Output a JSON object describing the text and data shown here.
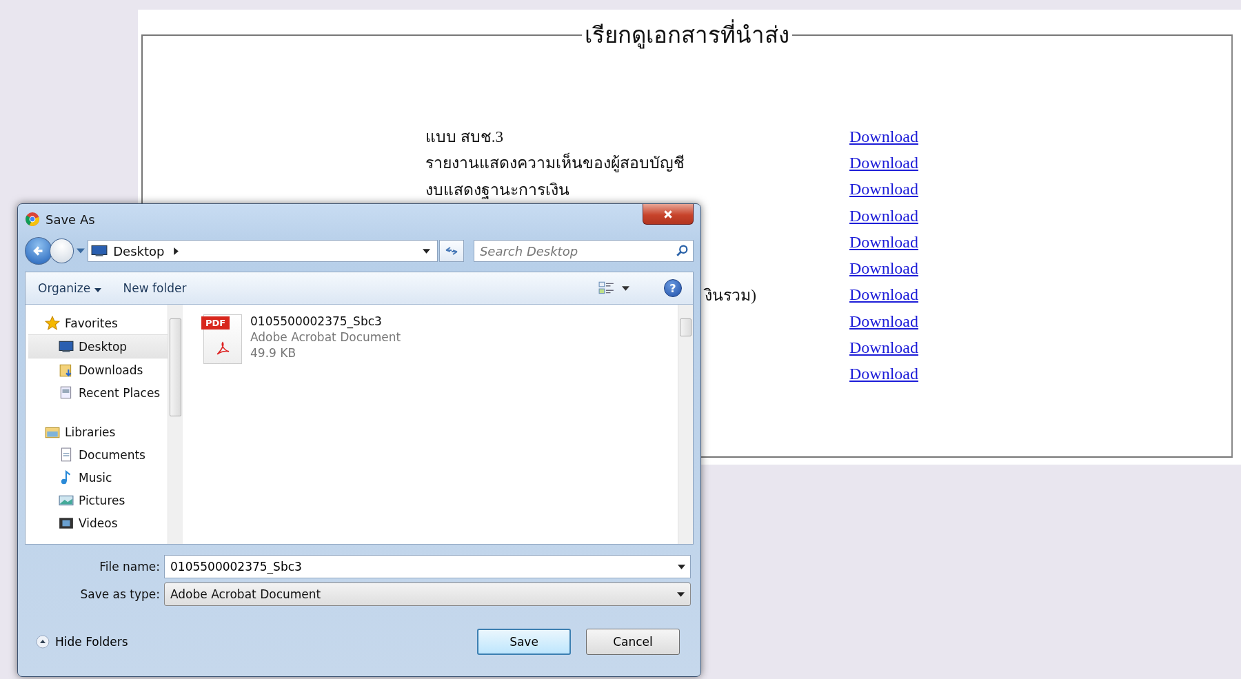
{
  "page": {
    "legend": "เรียกดูเอกสารที่นำส่ง",
    "rows": [
      {
        "label": "แบบ สบช.3",
        "kind": "full",
        "link": "Download"
      },
      {
        "label": "รายงานแสดงความเห็นของผู้สอบบัญชี",
        "kind": "full",
        "link": "Download"
      },
      {
        "label": "งบแสดงฐานะการเงิน",
        "kind": "full",
        "link": "Download"
      },
      {
        "link": "Download"
      },
      {
        "link": "Download"
      },
      {
        "link": "Download"
      },
      {
        "label": "งินรวม)",
        "kind": "cut",
        "link": "Download"
      },
      {
        "link": "Download"
      },
      {
        "link": "Download"
      },
      {
        "link": "Download"
      }
    ]
  },
  "dialog": {
    "title": "Save As",
    "address": {
      "location": "Desktop",
      "search_placeholder": "Search Desktop"
    },
    "toolbar": {
      "organize": "Organize",
      "new_folder": "New folder",
      "help": "?"
    },
    "nav": [
      {
        "label": "Favorites",
        "children": [
          {
            "label": "Desktop",
            "selected": true
          },
          {
            "label": "Downloads",
            "selected": false
          },
          {
            "label": "Recent Places",
            "selected": false
          }
        ]
      },
      {
        "label": "Libraries",
        "children": [
          {
            "label": "Documents",
            "selected": false
          },
          {
            "label": "Music",
            "selected": false
          },
          {
            "label": "Pictures",
            "selected": false
          },
          {
            "label": "Videos",
            "selected": false
          }
        ]
      }
    ],
    "files": [
      {
        "badge": "PDF",
        "name": "0105500002375_Sbc3",
        "type": "Adobe Acrobat Document",
        "size": "49.9 KB"
      }
    ],
    "file_name": {
      "label": "File name:",
      "value": "0105500002375_Sbc3"
    },
    "save_as_type": {
      "label": "Save as type:",
      "value": "Adobe Acrobat Document"
    },
    "hide_folders": "Hide Folders",
    "buttons": [
      {
        "label": "Save",
        "default": true
      },
      {
        "label": "Cancel",
        "default": false
      }
    ]
  }
}
